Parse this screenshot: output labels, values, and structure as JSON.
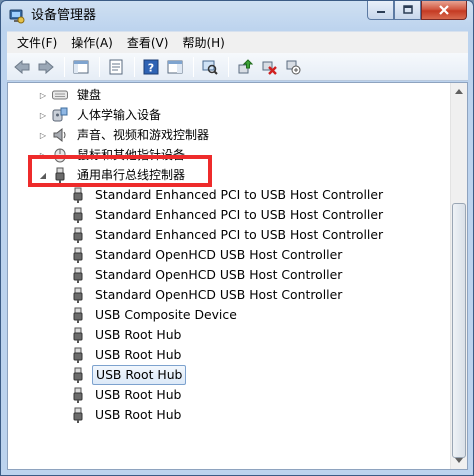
{
  "window": {
    "title": "设备管理器"
  },
  "menu": {
    "items": [
      "文件(F)",
      "操作(A)",
      "查看(V)",
      "帮助(H)"
    ]
  },
  "tree": {
    "collapsed": [
      {
        "label": "键盘",
        "icon": "keyboard-icon"
      },
      {
        "label": "人体学输入设备",
        "icon": "hid-icon"
      },
      {
        "label": "声音、视频和游戏控制器",
        "icon": "speaker-icon"
      },
      {
        "label": "鼠标和其他指针设备",
        "icon": "mouse-icon"
      }
    ],
    "expanded": {
      "label": "通用串行总线控制器",
      "icon": "usb-plug-icon"
    },
    "children": [
      "Standard Enhanced PCI to USB Host Controller",
      "Standard Enhanced PCI to USB Host Controller",
      "Standard Enhanced PCI to USB Host Controller",
      "Standard OpenHCD USB Host Controller",
      "Standard OpenHCD USB Host Controller",
      "Standard OpenHCD USB Host Controller",
      "USB Composite Device",
      "USB Root Hub",
      "USB Root Hub",
      "USB Root Hub",
      "USB Root Hub",
      "USB Root Hub"
    ],
    "selected_index": 9
  },
  "colors": {
    "highlight": "#ee2b2b",
    "selection_border": "#7da2ce"
  }
}
